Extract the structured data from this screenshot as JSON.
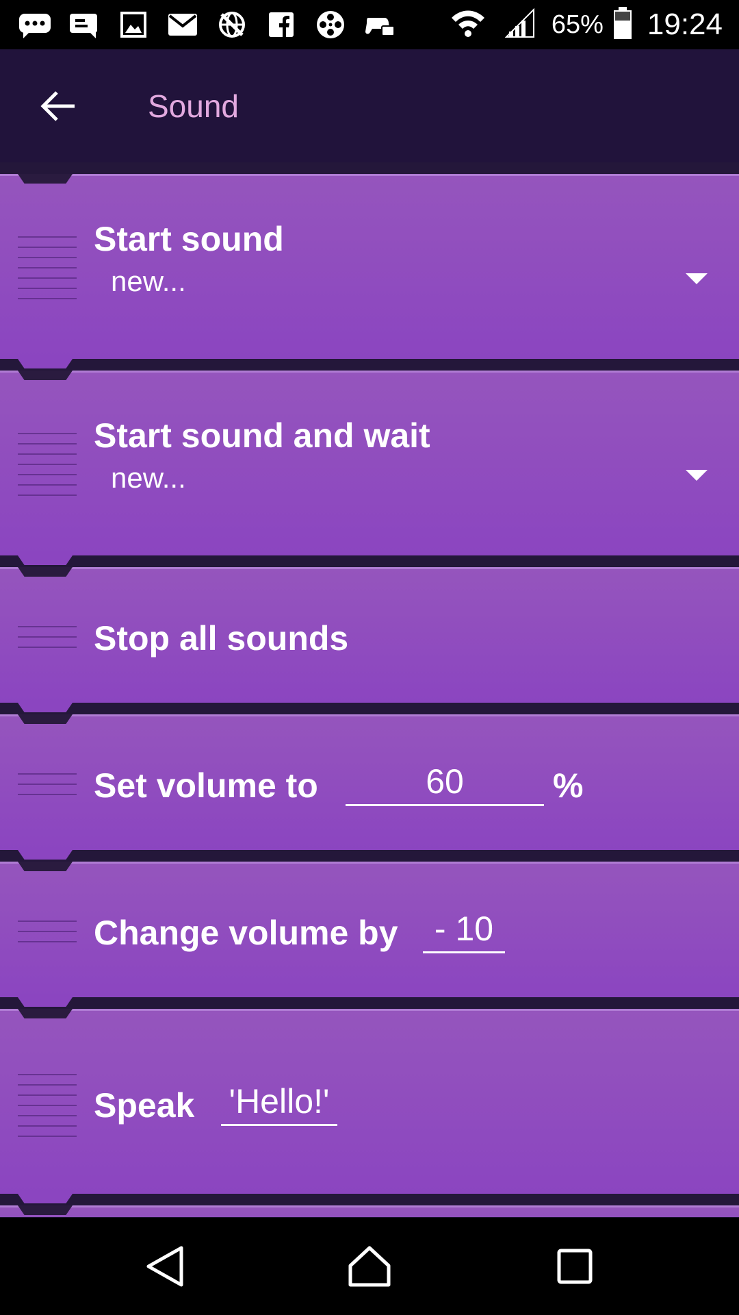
{
  "status_bar": {
    "left_icons": [
      "chat-bubble-icon",
      "message-icon",
      "image-icon",
      "mail-icon",
      "no-globe-icon",
      "facebook-icon",
      "film-reel-icon",
      "game-controller-icon"
    ],
    "battery": "65%",
    "time": "19:24"
  },
  "app_bar": {
    "back_icon": "arrow-left-icon",
    "title": "Sound"
  },
  "bricks": [
    {
      "title": "Start sound",
      "spinner": "new..."
    },
    {
      "title": "Start sound and wait",
      "spinner": "new..."
    },
    {
      "title": "Stop all sounds"
    },
    {
      "title": "Set volume to",
      "value": "60",
      "unit": "%"
    },
    {
      "title": "Change volume by",
      "value": "- 10"
    },
    {
      "title": "Speak",
      "value": "'Hello!'"
    }
  ],
  "nav_bar": {
    "icons": [
      "back-triangle-icon",
      "home-icon",
      "recents-square-icon"
    ]
  },
  "colors": {
    "brick_purple": "#8b45c0",
    "app_bar": "#21133b",
    "title_pink": "#e2a9df"
  }
}
